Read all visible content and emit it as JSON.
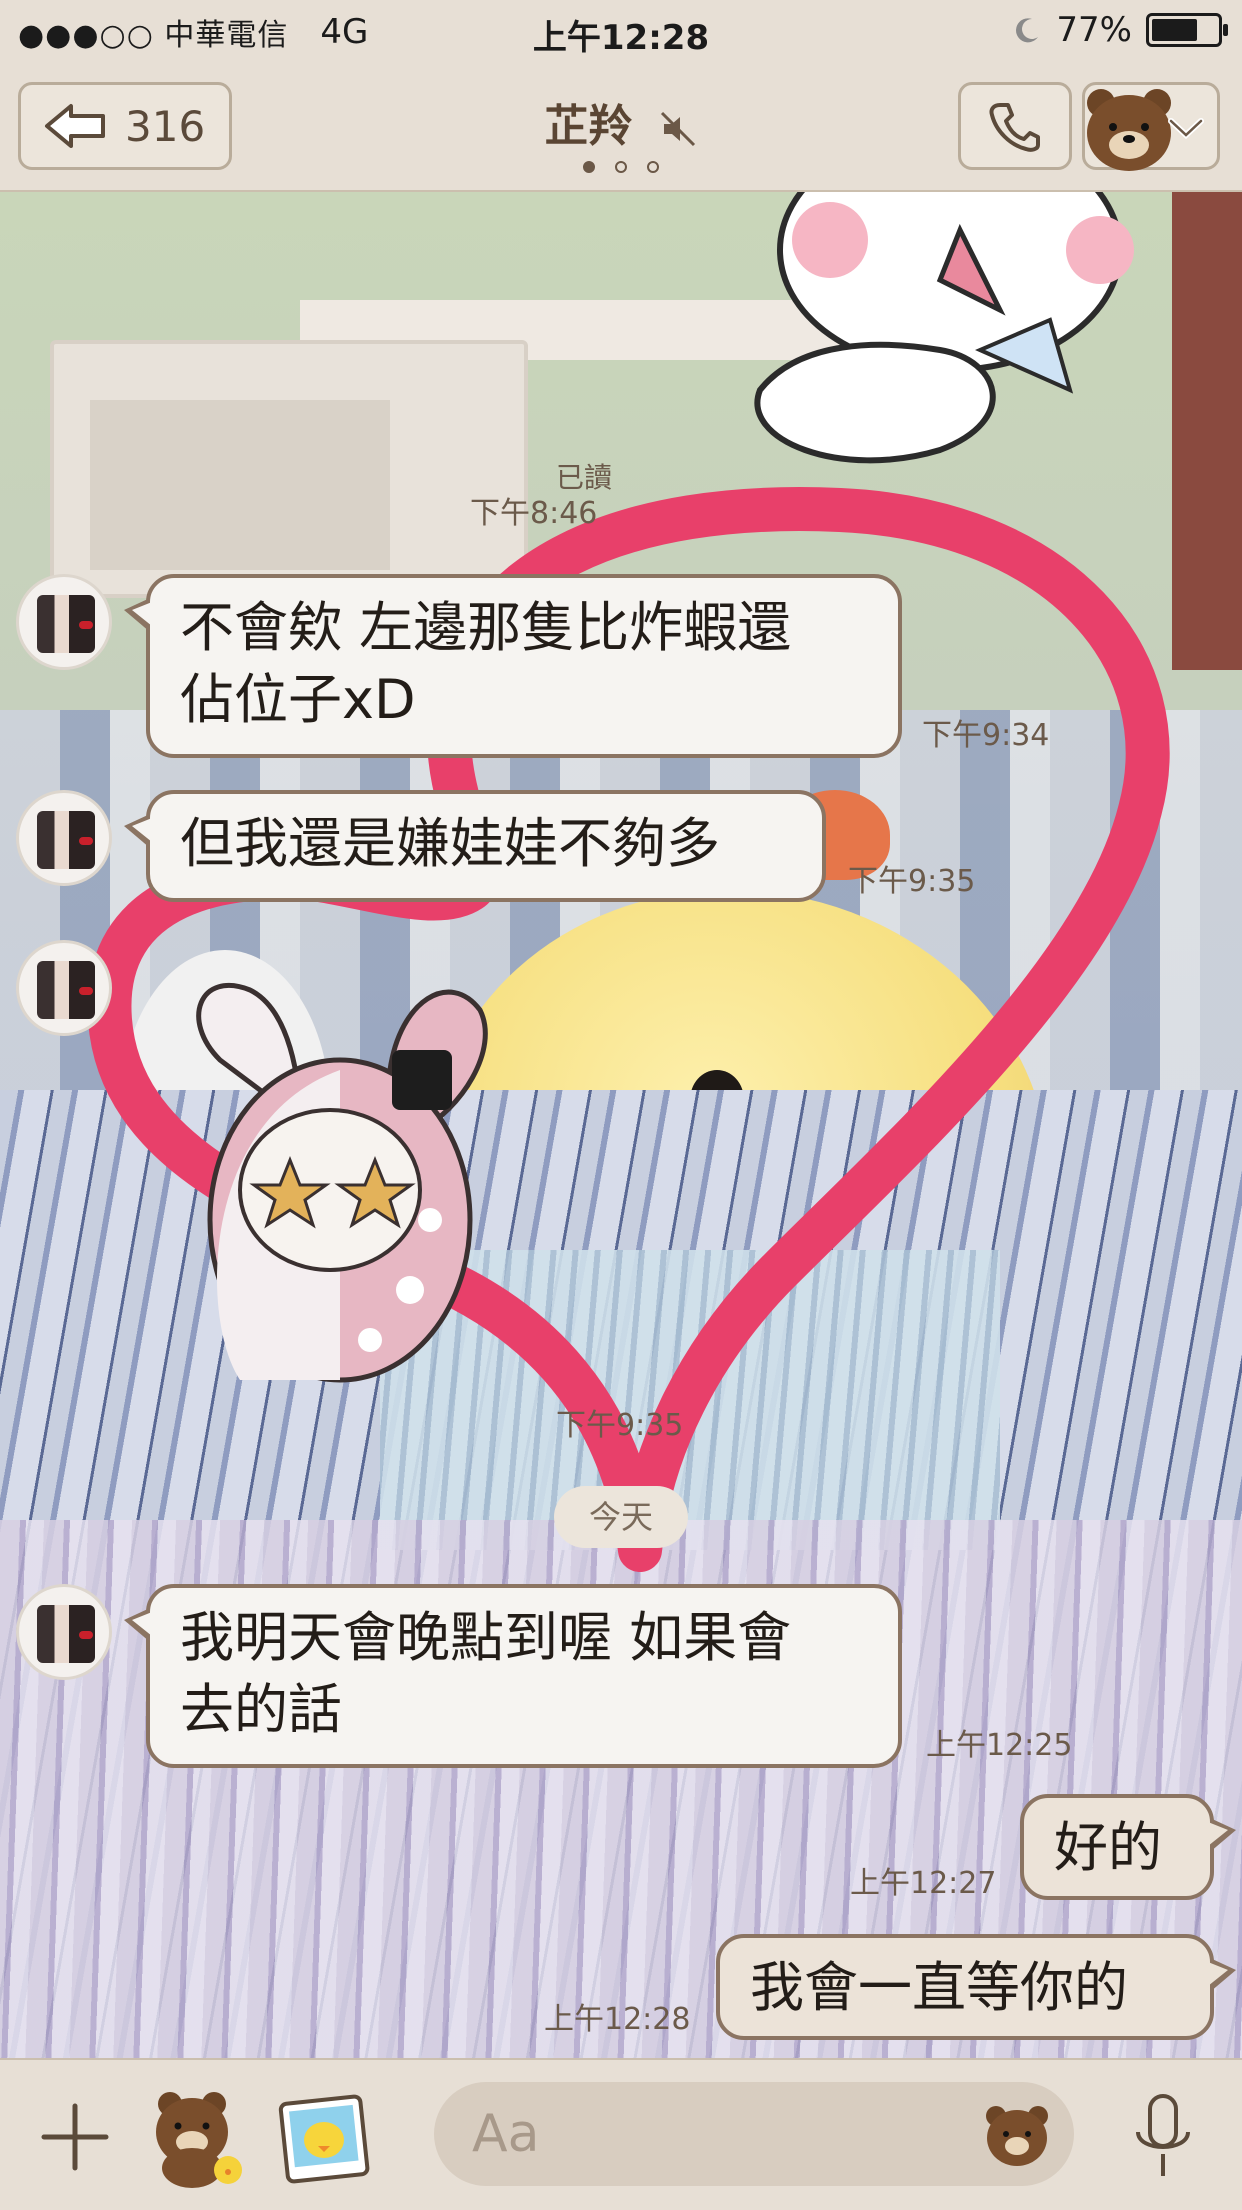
{
  "status_bar": {
    "carrier": "●●●○○ 中華電信",
    "network": "4G",
    "time": "上午12:28",
    "battery_percent": "77%",
    "battery_level": 0.77
  },
  "nav": {
    "back_count": "316",
    "title": "芷羚",
    "page_indicator_total": 3,
    "page_indicator_active": 0
  },
  "messages": {
    "read_label": "已讀",
    "read_time": "下午8:46",
    "m1_text_line1": "不會欸 左邊那隻比炸蝦還",
    "m1_text_line2": "佔位子xD",
    "m1_time": "下午9:34",
    "m2_text": "但我還是嫌娃娃不夠多",
    "m2_time": "下午9:35",
    "m3_time": "下午9:35",
    "date_divider": "今天",
    "m4_text_line1": "我明天會晚點到喔 如果會",
    "m4_text_line2": "去的話",
    "m4_time": "上午12:25",
    "m5_text": "好的",
    "m5_time": "上午12:27",
    "m6_text": "我會一直等你的",
    "m6_time": "上午12:28"
  },
  "input": {
    "placeholder": "Aa"
  },
  "icons": {
    "back": "back-arrow-icon",
    "mute": "mute-speaker-icon",
    "call": "phone-icon",
    "menu": "bear-avatar-icon",
    "chevron": "chevron-down-icon",
    "plus": "plus-icon",
    "sticker1": "brown-bear-sticker-icon",
    "sticker2": "sally-photo-icon",
    "emoji": "bear-face-icon",
    "mic": "microphone-icon"
  },
  "colors": {
    "bar_bg": "#e7dfd5",
    "bubble_border": "#8b7462",
    "heart_pink": "#e8406a"
  }
}
